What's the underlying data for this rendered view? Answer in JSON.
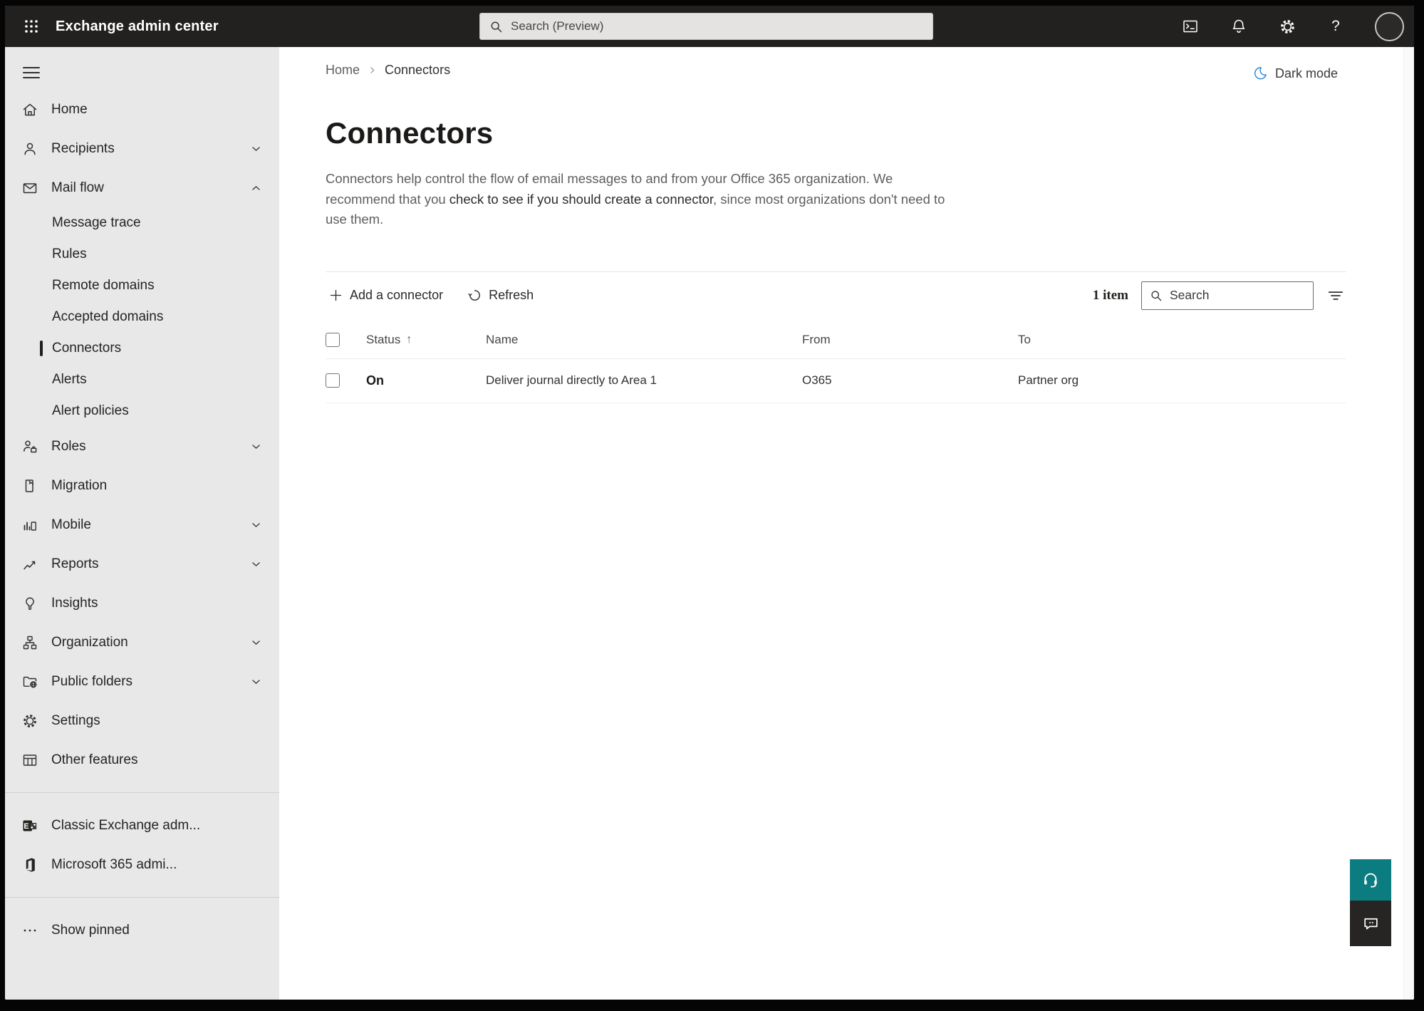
{
  "topbar": {
    "app_title": "Exchange admin center",
    "search_placeholder": "Search (Preview)"
  },
  "sidebar": {
    "items": [
      {
        "label": "Home",
        "icon": "home-icon"
      },
      {
        "label": "Recipients",
        "icon": "person-icon",
        "chevron": "down"
      },
      {
        "label": "Mail flow",
        "icon": "mail-icon",
        "chevron": "up",
        "expanded": true
      },
      {
        "label": "Message trace",
        "type": "sub"
      },
      {
        "label": "Rules",
        "type": "sub"
      },
      {
        "label": "Remote domains",
        "type": "sub"
      },
      {
        "label": "Accepted domains",
        "type": "sub"
      },
      {
        "label": "Connectors",
        "type": "sub",
        "selected": true
      },
      {
        "label": "Alerts",
        "type": "sub"
      },
      {
        "label": "Alert policies",
        "type": "sub"
      },
      {
        "label": "Roles",
        "icon": "roles-icon",
        "chevron": "down"
      },
      {
        "label": "Migration",
        "icon": "migration-icon"
      },
      {
        "label": "Mobile",
        "icon": "mobile-icon",
        "chevron": "down"
      },
      {
        "label": "Reports",
        "icon": "reports-icon",
        "chevron": "down"
      },
      {
        "label": "Insights",
        "icon": "lightbulb-icon"
      },
      {
        "label": "Organization",
        "icon": "org-chart-icon",
        "chevron": "down"
      },
      {
        "label": "Public folders",
        "icon": "folder-globe-icon",
        "chevron": "down"
      },
      {
        "label": "Settings",
        "icon": "gear-icon"
      },
      {
        "label": "Other features",
        "icon": "table-icon"
      },
      {
        "label": "Classic Exchange adm...",
        "icon": "classic-exchange-icon"
      },
      {
        "label": "Microsoft 365 admi...",
        "icon": "microsoft-365-icon"
      },
      {
        "label": "Show pinned",
        "icon": "ellipsis-icon"
      }
    ]
  },
  "main": {
    "breadcrumb": {
      "home": "Home",
      "current": "Connectors"
    },
    "dark_mode_label": "Dark mode",
    "page_title": "Connectors",
    "description": {
      "before_link": "Connectors help control the flow of email messages to and from your Office 365 organization. We recommend that you ",
      "link": "check to see if you should create a connector",
      "after_link": ", since most organizations don't need to use them."
    },
    "toolbar": {
      "add_label": "Add a connector",
      "refresh_label": "Refresh",
      "item_count": "1 item",
      "search_placeholder": "Search"
    },
    "table": {
      "headers": {
        "status": "Status",
        "name": "Name",
        "from": "From",
        "to": "To"
      },
      "sort": {
        "column": "Status",
        "direction": "ascending",
        "arrow": "↑"
      },
      "rows": [
        {
          "status": "On",
          "name": "Deliver journal directly to Area 1",
          "from": "O365",
          "to": "Partner org"
        }
      ]
    }
  },
  "colors": {
    "topbar": "#222120",
    "sidebar_bg": "#e9e8e8",
    "accent_moon_blue": "#2b88d8",
    "teal_help_button": "#0b7c80",
    "feedback_button": "#262524"
  }
}
